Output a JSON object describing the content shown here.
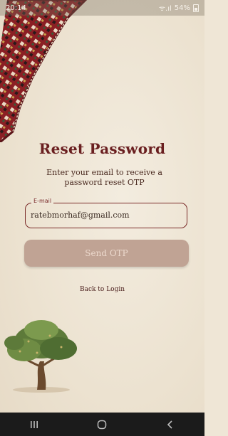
{
  "status_bar": {
    "time": "20:14",
    "signal": "ᯤ.ıl",
    "battery": "54%"
  },
  "screen": {
    "title": "Reset Password",
    "subtitle": "Enter your email to receive a password reset OTP",
    "email_field": {
      "label": "E-mail",
      "value": "ratebmorhaf@gmail.com"
    },
    "send_button_label": "Send OTP",
    "back_link_label": "Back to Login"
  },
  "colors": {
    "title": "#6a1f20",
    "accent": "#7a2a28",
    "button_bg": "#c0a394",
    "background": "#efe6d6"
  },
  "icons": {
    "decor_top": "carpet-pattern",
    "decor_bottom": "olive-tree",
    "nav": [
      "recent-apps-icon",
      "home-icon",
      "back-icon"
    ]
  }
}
